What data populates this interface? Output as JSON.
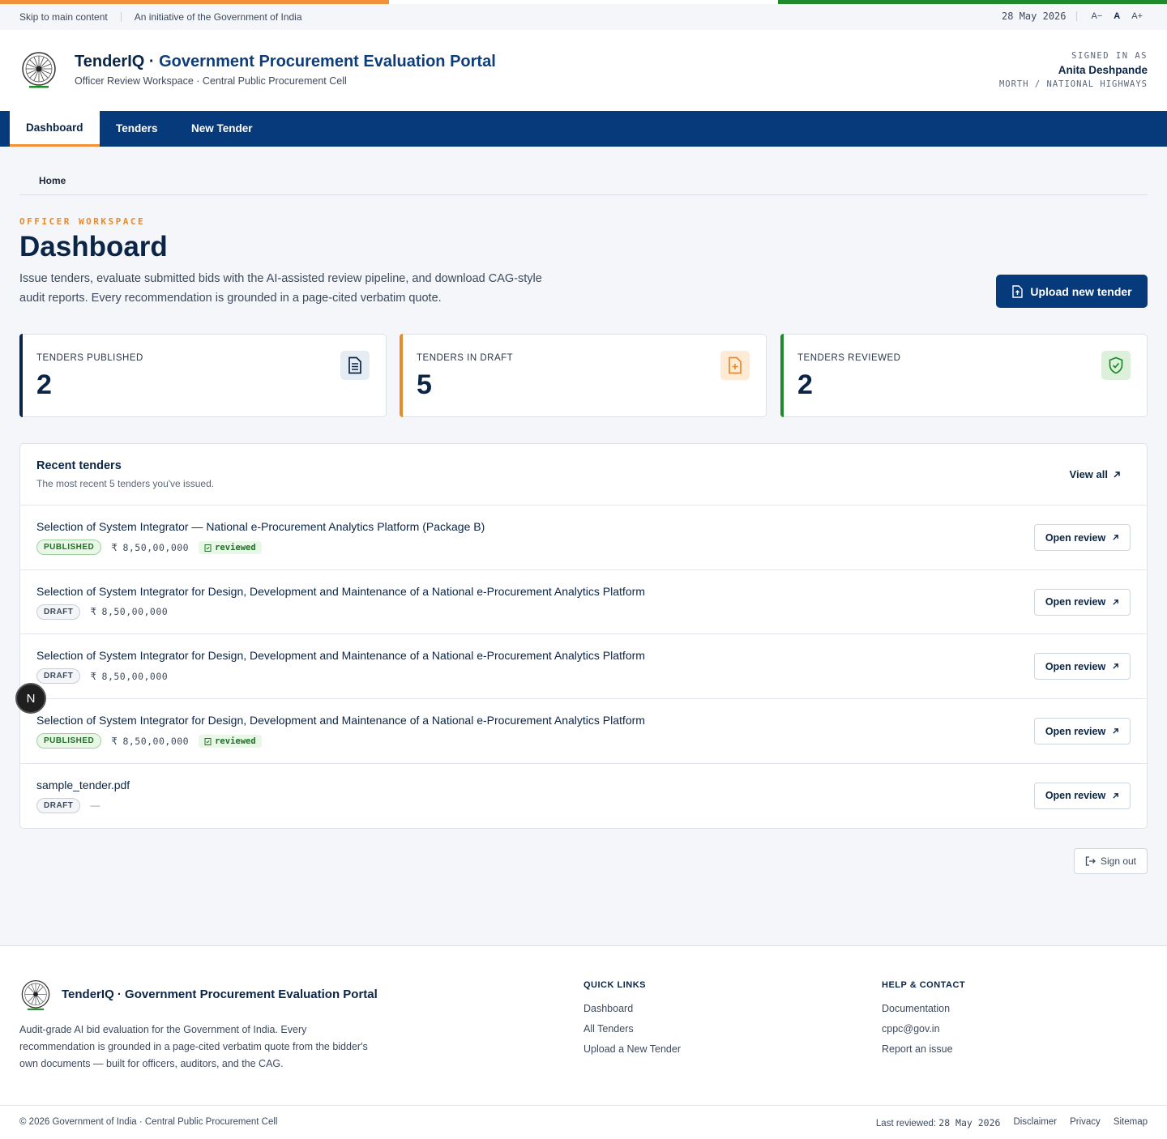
{
  "utility": {
    "skip": "Skip to main content",
    "initiative": "An initiative of the Government of India",
    "date": "28 May 2026",
    "font_small": "A−",
    "font_normal": "A",
    "font_large": "A+"
  },
  "masthead": {
    "brand_prefix": "TenderIQ · ",
    "brand_main": "Government Procurement Evaluation Portal",
    "subtitle": "Officer Review Workspace · Central Public Procurement Cell",
    "signed_label": "SIGNED IN AS",
    "user_name": "Anita Deshpande",
    "user_dept": "MORTH / NATIONAL HIGHWAYS"
  },
  "nav": {
    "tabs": [
      {
        "label": "Dashboard",
        "active": true
      },
      {
        "label": "Tenders",
        "active": false
      },
      {
        "label": "New Tender",
        "active": false
      }
    ]
  },
  "breadcrumb": {
    "home": "Home"
  },
  "header": {
    "eyebrow": "OFFICER WORKSPACE",
    "title": "Dashboard",
    "description": "Issue tenders, evaluate submitted bids with the AI-assisted review pipeline, and download CAG-style audit reports. Every recommendation is grounded in a page-cited verbatim quote.",
    "upload_label": "Upload new tender"
  },
  "stats": [
    {
      "label": "TENDERS PUBLISHED",
      "value": "2",
      "icon": "document-icon",
      "color": "#0b2546"
    },
    {
      "label": "TENDERS IN DRAFT",
      "value": "5",
      "icon": "file-plus-icon",
      "color": "#e8892c"
    },
    {
      "label": "TENDERS REVIEWED",
      "value": "2",
      "icon": "shield-check-icon",
      "color": "#1f8a2a"
    }
  ],
  "recent": {
    "title": "Recent tenders",
    "subtitle": "The most recent 5 tenders you've issued.",
    "view_all": "View all",
    "open_label": "Open review",
    "rows": [
      {
        "title": "Selection of System Integrator — National e-Procurement Analytics Platform (Package B)",
        "status": "PUBLISHED",
        "amount": "8,50,00,000",
        "rupee": "₹",
        "reviewed": "reviewed"
      },
      {
        "title": "Selection of System Integrator for Design, Development and Maintenance of a National e-Procurement Analytics Platform",
        "status": "DRAFT",
        "amount": "8,50,00,000",
        "rupee": "₹",
        "reviewed": ""
      },
      {
        "title": "Selection of System Integrator for Design, Development and Maintenance of a National e-Procurement Analytics Platform",
        "status": "DRAFT",
        "amount": "8,50,00,000",
        "rupee": "₹",
        "reviewed": ""
      },
      {
        "title": "Selection of System Integrator for Design, Development and Maintenance of a National e-Procurement Analytics Platform",
        "status": "PUBLISHED",
        "amount": "8,50,00,000",
        "rupee": "₹",
        "reviewed": "reviewed"
      },
      {
        "title": "sample_tender.pdf",
        "status": "DRAFT",
        "amount": "",
        "rupee": "",
        "reviewed": "",
        "placeholder": "—"
      }
    ]
  },
  "signout_label": "Sign out",
  "floating_badge": "N",
  "footer": {
    "brand": "TenderIQ · Government Procurement Evaluation Portal",
    "description": "Audit-grade AI bid evaluation for the Government of India. Every recommendation is grounded in a page-cited verbatim quote from the bidder's own documents — built for officers, auditors, and the CAG.",
    "quick_links_title": "QUICK LINKS",
    "quick_links": [
      "Dashboard",
      "All Tenders",
      "Upload a New Tender"
    ],
    "help_title": "HELP & CONTACT",
    "help_links": [
      "Documentation",
      "cppc@gov.in",
      "Report an issue"
    ],
    "copyright": "© 2026 Government of India · Central Public Procurement Cell",
    "last_reviewed_label": "Last reviewed: ",
    "last_reviewed_date": "28 May 2026",
    "bottom_links": [
      "Disclaimer",
      "Privacy",
      "Sitemap"
    ]
  }
}
